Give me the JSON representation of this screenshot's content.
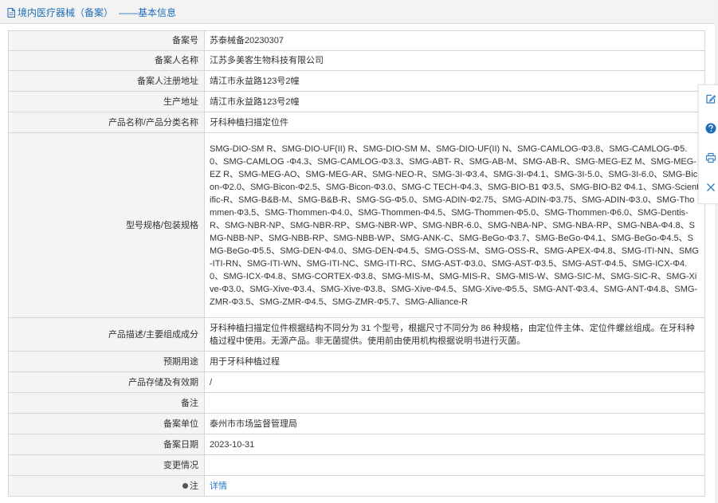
{
  "header": {
    "title": "境内医疗器械（备案）",
    "subtitle": "——基本信息"
  },
  "rows": [
    {
      "label": "备案号",
      "value": "苏泰械备20230307"
    },
    {
      "label": "备案人名称",
      "value": "江苏多美客生物科技有限公司"
    },
    {
      "label": "备案人注册地址",
      "value": "靖江市永益路123号2幢"
    },
    {
      "label": "生产地址",
      "value": "靖江市永益路123号2幢"
    },
    {
      "label": "产品名称/产品分类名称",
      "value": "牙科种植扫描定位件"
    },
    {
      "label": "型号规格/包装规格",
      "value": "SMG-DIO-SM R、SMG-DIO-UF(II) R、SMG-DIO-SM M、SMG-DIO-UF(II) N、SMG-CAMLOG-Φ3.8、SMG-CAMLOG-Φ5.0、SMG-CAMLOG -Φ4.3、SMG-CAMLOG-Φ3.3、SMG-ABT- R、SMG-AB-M、SMG-AB-R、SMG-MEG-EZ M、SMG-MEG-EZ R、SMG-MEG-AO、SMG-MEG-AR、SMG-NEO-R、SMG-3I-Φ3.4、SMG-3I-Φ4.1、SMG-3I-5.0、SMG-3I-6.0、SMG-Bicon-Φ2.0、SMG-Bicon-Φ2.5、SMG-Bicon-Φ3.0、SMG-C TECH-Φ4.3、SMG-BIO-B1 Φ3.5、SMG-BIO-B2 Φ4.1、SMG-Scientific-R、SMG-B&B-M、SMG-B&B-R、SMG-SG-Φ5.0、SMG-ADIN-Φ2.75、SMG-ADIN-Φ3.75、SMG-ADIN-Φ3.0、SMG-Thommen-Φ3.5、SMG-Thommen-Φ4.0、SMG-Thommen-Φ4.5、SMG-Thommen-Φ5.0、SMG-Thommen-Φ6.0、SMG-Dentis-R、SMG-NBR-NP、SMG-NBR-RP、SMG-NBR-WP、SMG-NBR-6.0、SMG-NBA-NP、SMG-NBA-RP、SMG-NBA-Φ4.8、SMG-NBB-NP、SMG-NBB-RP、SMG-NBB-WP、SMG-ANK-C、SMG-BeGo-Φ3.7、SMG-BeGo-Φ4.1、SMG-BeGo-Φ4.5、SMG-BeGo-Φ5.5、SMG-DEN-Φ4.0、SMG-DEN-Φ4.5、SMG-OSS-M、SMG-OSS-R、SMG-APEX-Φ4.8、SMG-ITI-NN、SMG-ITI-RN、SMG-ITI-WN、SMG-ITI-NC、SMG-ITI-RC、SMG-AST-Φ3.0、SMG-AST-Φ3.5、SMG-AST-Φ4.5、SMG-ICX-Φ4.0、SMG-ICX-Φ4.8、SMG-CORTEX-Φ3.8、SMG-MIS-M、SMG-MIS-R、SMG-MIS-W、SMG-SIC-M、SMG-SIC-R、SMG-Xive-Φ3.0、SMG-Xive-Φ3.4、SMG-Xive-Φ3.8、SMG-Xive-Φ4.5、SMG-Xive-Φ5.5、SMG-ANT-Φ3.4、SMG-ANT-Φ4.8、SMG-ZMR-Φ3.5、SMG-ZMR-Φ4.5、SMG-ZMR-Φ5.7、SMG-Alliance-R"
    },
    {
      "label": "产品描述/主要组成成分",
      "value": "牙科种植扫描定位件根据结构不同分为 31 个型号，根据尺寸不同分为 86 种规格，由定位件主体、定位件螺丝组成。在牙科种植过程中使用。无源产品。非无菌提供。使用前由使用机构根据说明书进行灭菌。"
    },
    {
      "label": "预期用途",
      "value": "用于牙科种植过程"
    },
    {
      "label": "产品存储及有效期",
      "value": "/"
    },
    {
      "label": "备注",
      "value": ""
    },
    {
      "label": "备案单位",
      "value": "泰州市市场监督管理局"
    },
    {
      "label": "备案日期",
      "value": "2023-10-31"
    },
    {
      "label": "变更情况",
      "value": ""
    },
    {
      "label": "注",
      "value": "详情"
    }
  ],
  "side_tools": [
    {
      "icon": "edit-icon"
    },
    {
      "icon": "help-icon"
    },
    {
      "icon": "print-icon"
    },
    {
      "icon": "close-icon"
    }
  ],
  "colors": {
    "accent": "#1e6eb8",
    "link": "#2a7ac6",
    "label_bg": "#f4f4f4",
    "border": "#d6d6d6"
  }
}
